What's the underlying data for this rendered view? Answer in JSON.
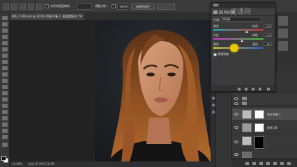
{
  "options_bar": {
    "sample_all_layers_label": "对所有图层取样",
    "value_field": "",
    "refine_edge_label": "调整边缘...",
    "opacity_field": "100%",
    "btn_a": "选择并遮住",
    "btn_b": "..."
  },
  "document": {
    "tab_title": "IMG_7149.psd @ 14.6% (色彩平衡 1, 图层蒙版/8) *",
    "close_glyph": "×"
  },
  "status_bar": {
    "zoom": "14.66%",
    "doc_info": "文档:19.1M/111.5M"
  },
  "properties": {
    "panel_title": "属性",
    "adjustment_title": "色彩平衡",
    "tone_label": "色调:",
    "tone_value": "中间调",
    "sliders": [
      {
        "left": "青色",
        "right": "红色",
        "value": "+32",
        "position": 0.66,
        "color_from": "#1fb5c9",
        "color_to": "#e23232"
      },
      {
        "left": "洋红",
        "right": "绿色",
        "value": "+14",
        "position": 0.57,
        "color_from": "#d23ad2",
        "color_to": "#3ac73a"
      },
      {
        "left": "黄色",
        "right": "蓝色",
        "value": "-10",
        "position": 0.45,
        "color_from": "#e6d22a",
        "color_to": "#2a5be0"
      }
    ],
    "preserve_luminosity_label": "保留明度",
    "preserve_luminosity_checked": true,
    "check_glyph": "✓"
  },
  "layers": [
    {
      "name": "",
      "type": "group"
    },
    {
      "name": "",
      "type": "group"
    },
    {
      "name": "色彩平衡 1",
      "type": "adjustment",
      "selected": false
    },
    {
      "name": "曲线 18",
      "type": "adjustment",
      "selected": false
    },
    {
      "name": "",
      "type": "mask",
      "selected": false
    },
    {
      "name": "",
      "type": "image",
      "selected": false
    }
  ],
  "watermark_text": "虎课网"
}
